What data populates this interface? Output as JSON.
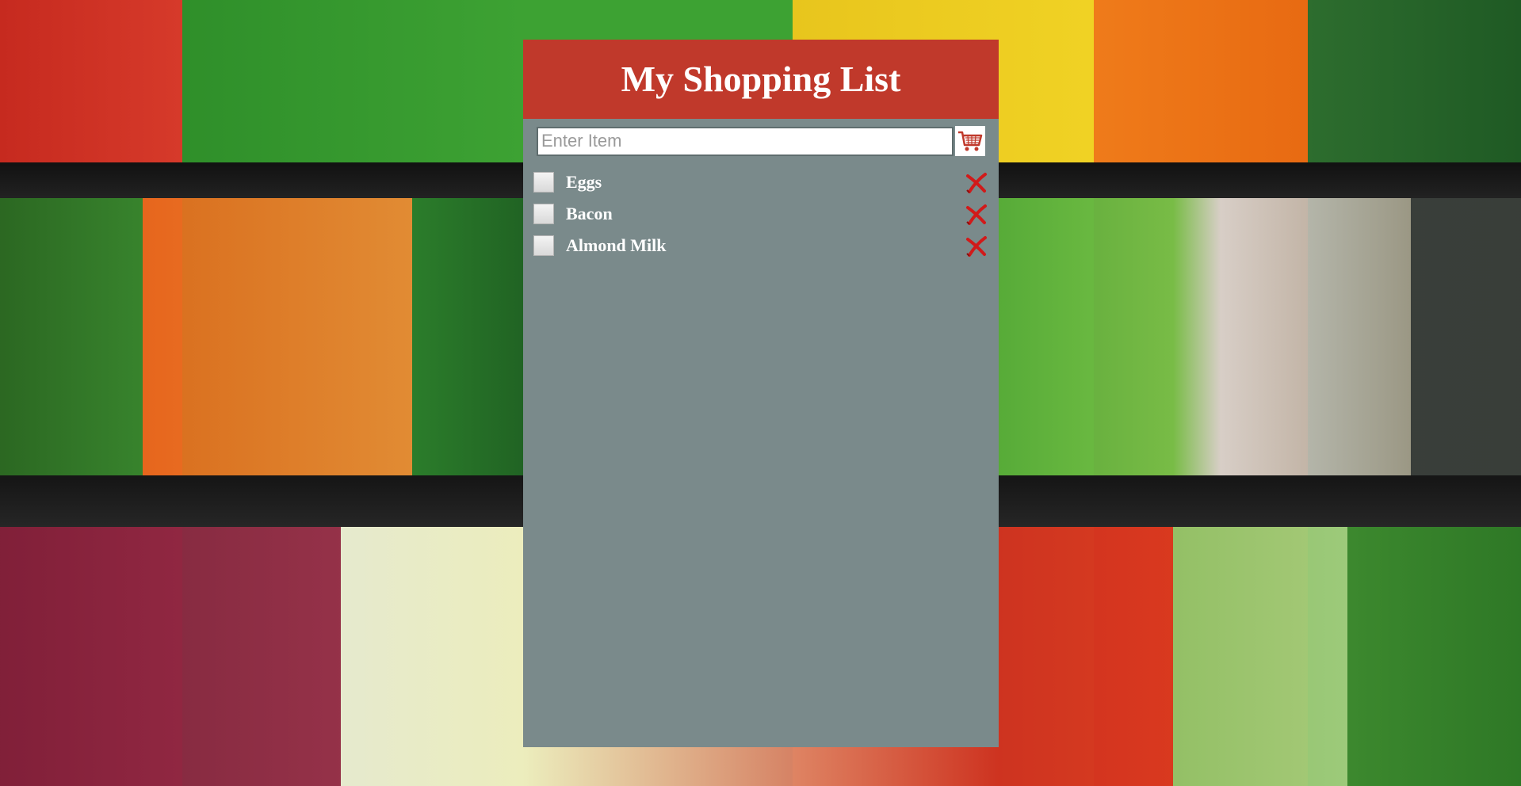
{
  "app": {
    "title": "My Shopping List"
  },
  "entry": {
    "placeholder": "Enter Item",
    "value": "",
    "add_icon": "shopping-cart-icon"
  },
  "items": [
    {
      "label": "Eggs",
      "checked": false,
      "delete_icon": "red-x-icon"
    },
    {
      "label": "Bacon",
      "checked": false,
      "delete_icon": "red-x-icon"
    },
    {
      "label": "Almond Milk",
      "checked": false,
      "delete_icon": "red-x-icon"
    }
  ],
  "colors": {
    "header": "#c0392b",
    "panel": "#7a8a8b",
    "delete": "#d11a1a"
  }
}
